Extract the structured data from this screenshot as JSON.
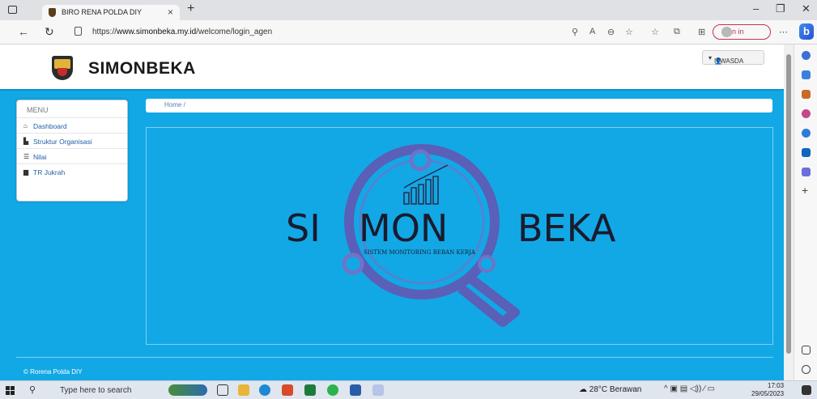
{
  "browser": {
    "tab_title": "BIRO RENA POLDA DIY",
    "url_prefix": "https://",
    "url_domain": "www.simonbeka.my.id",
    "url_path": "/welcome/login_agen",
    "sign_in_label": "Sign in"
  },
  "header": {
    "brand": "SIMONBEKA",
    "user_label": "ITWASDA"
  },
  "sidebar": {
    "heading": "MENU",
    "items": [
      {
        "label": "Dashboard",
        "icon": "home-icon"
      },
      {
        "label": "Struktur Organisasi",
        "icon": "book-icon"
      },
      {
        "label": "Nilai",
        "icon": "list-icon"
      },
      {
        "label": "TR Jukrah",
        "icon": "folder-icon"
      }
    ]
  },
  "breadcrumb": {
    "home": "Home /"
  },
  "hero": {
    "logo_left": "SI",
    "logo_mid": "MON",
    "logo_right": "BEKA",
    "tagline": "SISTEM MONITORING BEBAN KERJA"
  },
  "footer": {
    "text": "© Rorena Polda DIY"
  },
  "taskbar": {
    "search_placeholder": "Type here to search",
    "weather": "28°C  Berawan",
    "time": "17:03",
    "date": "29/05/2023"
  },
  "colors": {
    "page_bg": "#12a8e6",
    "logo_ring": "#5a5fb8",
    "logo_text": "#1b1b2e",
    "sign_in": "#c4314b"
  }
}
